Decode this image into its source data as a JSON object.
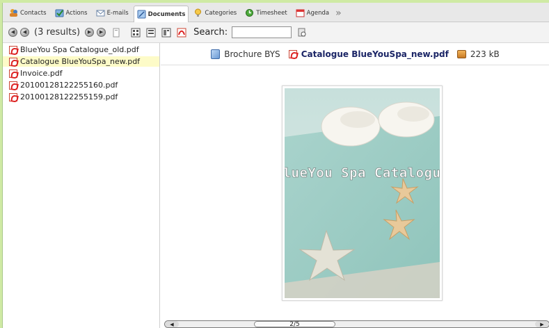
{
  "tabs": [
    {
      "label": "Contacts",
      "icon": "contacts-icon",
      "active": false
    },
    {
      "label": "Actions",
      "icon": "actions-icon",
      "active": false
    },
    {
      "label": "E-mails",
      "icon": "email-icon",
      "active": false
    },
    {
      "label": "Documents",
      "icon": "documents-icon",
      "active": true
    },
    {
      "label": "Categories",
      "icon": "categories-icon",
      "active": false
    },
    {
      "label": "Timesheet",
      "icon": "timesheet-icon",
      "active": false
    },
    {
      "label": "Agenda",
      "icon": "agenda-icon",
      "active": false
    }
  ],
  "toolbar": {
    "results": "(3 results)",
    "search_label": "Search:",
    "search_value": ""
  },
  "files": [
    {
      "name": "BlueYou Spa Catalogue_old.pdf",
      "selected": false
    },
    {
      "name": "Catalogue BlueYouSpa_new.pdf",
      "selected": true
    },
    {
      "name": "Invoice.pdf",
      "selected": false
    },
    {
      "name": "20100128122255160.pdf",
      "selected": false
    },
    {
      "name": "20100128122255159.pdf",
      "selected": false
    }
  ],
  "preview": {
    "folder": "Brochure BYS",
    "file": "Catalogue BlueYouSpa_new.pdf",
    "size": "223 kB",
    "page_text": "BlueYou Spa Catalogue",
    "page_indicator": "2/5"
  },
  "colors": {
    "background": "#cfeaa4",
    "selected_row": "#fdfbc8",
    "accent_text": "#1b2566"
  }
}
